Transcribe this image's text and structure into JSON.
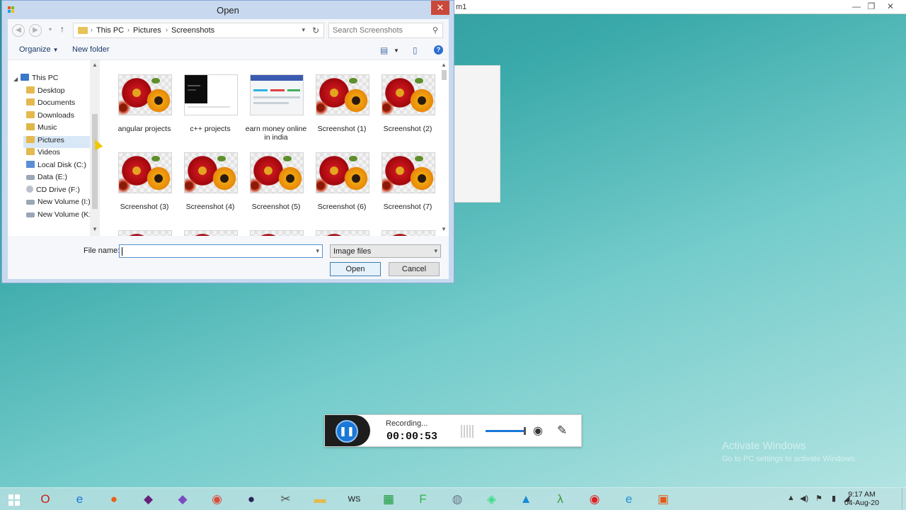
{
  "background_window": {
    "title_fragment": "m1"
  },
  "dialog": {
    "title": "Open",
    "close_glyph": "✕",
    "breadcrumb": [
      "This PC",
      "Pictures",
      "Screenshots"
    ],
    "search_placeholder": "Search Screenshots",
    "toolbar": {
      "organize": "Organize",
      "new_folder": "New folder"
    },
    "nav_tree": [
      {
        "label": "This PC",
        "icon": "computer-icon"
      },
      {
        "label": "Desktop",
        "icon": "folder-icon"
      },
      {
        "label": "Documents",
        "icon": "folder-icon"
      },
      {
        "label": "Downloads",
        "icon": "folder-icon"
      },
      {
        "label": "Music",
        "icon": "music-folder-icon"
      },
      {
        "label": "Pictures",
        "icon": "folder-icon",
        "selected": true
      },
      {
        "label": "Videos",
        "icon": "folder-icon"
      },
      {
        "label": "Local Disk (C:)",
        "icon": "windows-drive-icon"
      },
      {
        "label": "Data (E:)",
        "icon": "drive-icon"
      },
      {
        "label": "CD Drive (F:)",
        "icon": "cd-drive-icon"
      },
      {
        "label": "New Volume (I:)",
        "icon": "drive-icon"
      },
      {
        "label": "New Volume (K:)",
        "icon": "drive-icon"
      }
    ],
    "files": [
      {
        "name": "angular projects",
        "thumb": "flower"
      },
      {
        "name": "c++ projects",
        "thumb": "dark"
      },
      {
        "name": "earn money online in india",
        "thumb": "web"
      },
      {
        "name": "Screenshot (1)",
        "thumb": "flower"
      },
      {
        "name": "Screenshot (2)",
        "thumb": "flower"
      },
      {
        "name": "Screenshot (3)",
        "thumb": "flower"
      },
      {
        "name": "Screenshot (4)",
        "thumb": "flower"
      },
      {
        "name": "Screenshot (5)",
        "thumb": "flower"
      },
      {
        "name": "Screenshot (6)",
        "thumb": "flower"
      },
      {
        "name": "Screenshot (7)",
        "thumb": "flower"
      }
    ],
    "file_name_label": "File name:",
    "file_name_value": "",
    "file_type": "Image files",
    "open_button": "Open",
    "cancel_button": "Cancel"
  },
  "recorder": {
    "status": "Recording...",
    "time": "00:00:53"
  },
  "watermark": {
    "line1": "Activate Windows",
    "line2": "Go to PC settings to activate Windows."
  },
  "taskbar": {
    "apps": [
      {
        "icon": "opera-icon",
        "glyph": "O",
        "color": "#d21a1a"
      },
      {
        "icon": "internet-explorer-icon",
        "glyph": "e",
        "color": "#1e78d2"
      },
      {
        "icon": "firefox-icon",
        "glyph": "●",
        "color": "#e8621a"
      },
      {
        "icon": "visual-studio-icon",
        "glyph": "◆",
        "color": "#68217a"
      },
      {
        "icon": "visual-studio-2019-icon",
        "glyph": "◆",
        "color": "#7b4bc4"
      },
      {
        "icon": "chrome-icon",
        "glyph": "◉",
        "color": "#dd4b39"
      },
      {
        "icon": "eclipse-icon",
        "glyph": "●",
        "color": "#2c2255"
      },
      {
        "icon": "tools-icon",
        "glyph": "✂",
        "color": "#555555"
      },
      {
        "icon": "file-explorer-icon",
        "glyph": "▬",
        "color": "#e4ba4f"
      },
      {
        "icon": "webstorm-icon",
        "glyph": "WS",
        "color": "#111111"
      },
      {
        "icon": "store-icon",
        "glyph": "▦",
        "color": "#1a9a3a"
      },
      {
        "icon": "f-app-icon",
        "glyph": "F",
        "color": "#2db34a"
      },
      {
        "icon": "network-app-icon",
        "glyph": "◍",
        "color": "#6a7b8c"
      },
      {
        "icon": "android-studio-icon",
        "glyph": "◈",
        "color": "#3ddc84"
      },
      {
        "icon": "mountain-app-icon",
        "glyph": "▲",
        "color": "#1a8ad8"
      },
      {
        "icon": "lambda-app-icon",
        "glyph": "λ",
        "color": "#3a9a3a"
      },
      {
        "icon": "screen-recorder-icon",
        "glyph": "◉",
        "color": "#e02020"
      },
      {
        "icon": "edge-icon",
        "glyph": "e",
        "color": "#1f8fd8"
      },
      {
        "icon": "windows-flag-icon",
        "glyph": "▣",
        "color": "#e05a1a"
      }
    ],
    "time": "9:17 AM",
    "date": "04-Aug-20"
  }
}
